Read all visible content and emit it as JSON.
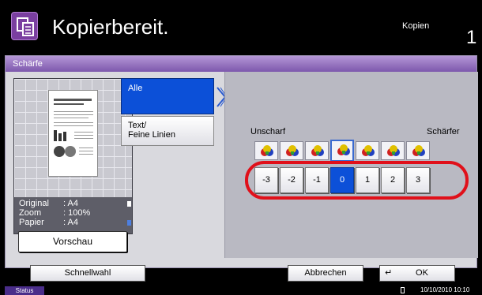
{
  "header": {
    "title": "Kopierbereit.",
    "mode": "Kopien",
    "count": "1"
  },
  "panel": {
    "title": "Schärfe"
  },
  "preview": {
    "original_label": "Original",
    "original_value": ": A4",
    "zoom_label": "Zoom",
    "zoom_value": ": 100%",
    "paper_label": "Papier",
    "paper_value": ": A4",
    "button": "Vorschau"
  },
  "modes": {
    "all": "Alle",
    "text_line1": "Text/",
    "text_line2": "Feine Linien"
  },
  "sharpness": {
    "left_label": "Unscharf",
    "right_label": "Schärfer",
    "values": [
      "-3",
      "-2",
      "-1",
      "0",
      "1",
      "2",
      "3"
    ],
    "selected": "0"
  },
  "bottom": {
    "quick": "Schnellwahl",
    "cancel": "Abbrechen",
    "ok": "OK"
  },
  "status": {
    "button": "Status",
    "datetime": "10/10/2010  10:10"
  },
  "colors": {
    "selected_blue": "#0c50d8",
    "header_purple": "#7d58ad",
    "highlight_red": "#e0101a"
  }
}
